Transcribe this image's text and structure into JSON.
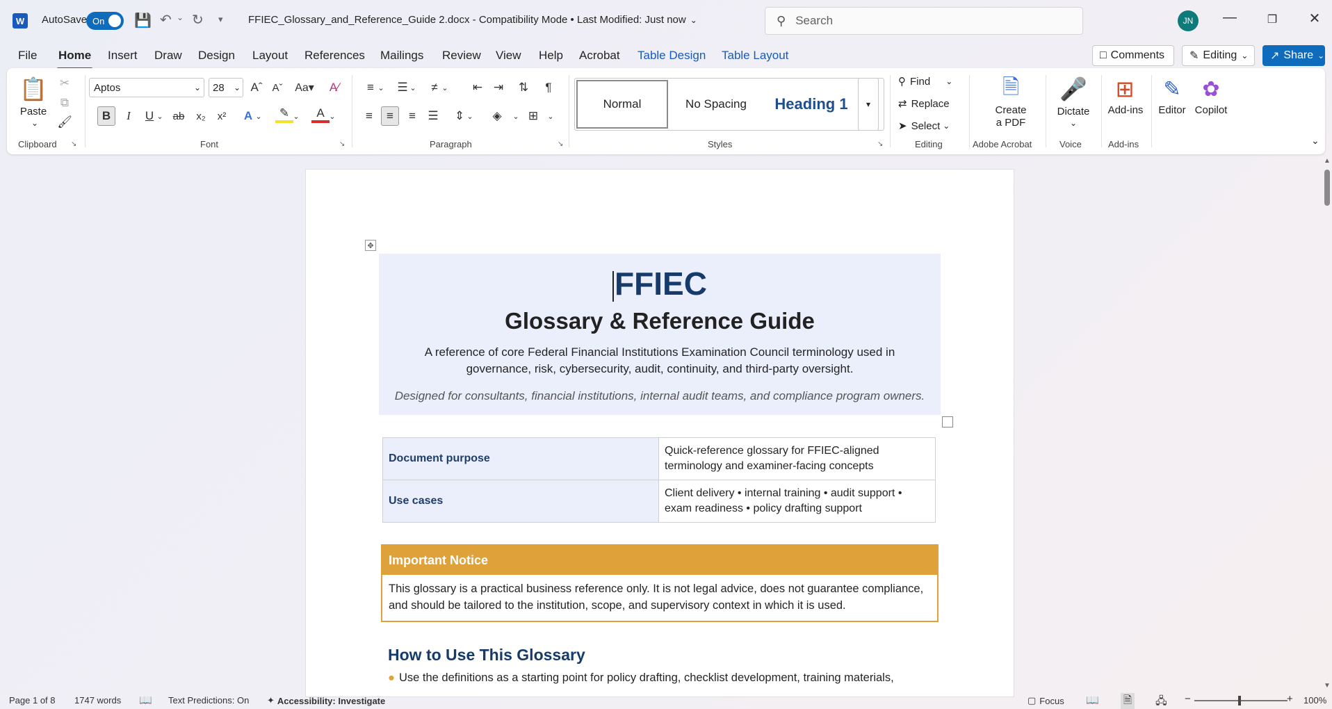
{
  "titlebar": {
    "app_logo": "W",
    "autosave_label": "AutoSave",
    "autosave_state": "On",
    "document_title": "FFIEC_Glossary_and_Reference_Guide 2.docx  -  Compatibility Mode •  Last Modified: Just now",
    "search_placeholder": "Search",
    "user_initials": "JN"
  },
  "menu": {
    "tabs": [
      "File",
      "Home",
      "Insert",
      "Draw",
      "Design",
      "Layout",
      "References",
      "Mailings",
      "Review",
      "View",
      "Help",
      "Acrobat",
      "Table Design",
      "Table Layout"
    ],
    "active_tab": "Home",
    "comments_label": "Comments",
    "editing_label": "Editing",
    "share_label": "Share"
  },
  "ribbon": {
    "clipboard": {
      "paste_label": "Paste",
      "group_label": "Clipboard"
    },
    "font": {
      "name": "Aptos",
      "size": "28",
      "group_label": "Font"
    },
    "paragraph": {
      "group_label": "Paragraph"
    },
    "styles": {
      "items": [
        "Normal",
        "No Spacing",
        "Heading 1"
      ],
      "group_label": "Styles"
    },
    "editing": {
      "find_label": "Find",
      "replace_label": "Replace",
      "select_label": "Select",
      "group_label": "Editing"
    },
    "acrobat": {
      "create_pdf_label_1": "Create",
      "create_pdf_label_2": "a PDF",
      "group_label": "Adobe Acrobat"
    },
    "voice": {
      "dictate_label": "Dictate",
      "group_label": "Voice"
    },
    "addins": {
      "addins_label": "Add-ins",
      "group_label": "Add-ins"
    },
    "editor_label": "Editor",
    "copilot_label": "Copilot"
  },
  "document": {
    "title": "FFIEC",
    "subtitle": "Glossary & Reference Guide",
    "description": "A reference of core Federal Financial Institutions Examination Council terminology used in governance, risk, cybersecurity, audit, continuity, and third-party oversight.",
    "tagline": "Designed for consultants, financial institutions, internal audit teams, and compliance program owners.",
    "info_rows": [
      {
        "key": "Document purpose",
        "value": "Quick-reference glossary for FFIEC-aligned terminology and examiner-facing concepts"
      },
      {
        "key": "Use cases",
        "value": "Client delivery • internal training • audit support • exam readiness • policy drafting support"
      }
    ],
    "notice_heading": "Important Notice",
    "notice_body": "This glossary is a practical business reference only. It is not legal advice, does not guarantee compliance, and should be tailored to the institution, scope, and supervisory context in which it is used.",
    "section_heading": "How to Use This Glossary",
    "bullet_1": "Use the definitions as a starting point for policy drafting, checklist development, training materials,"
  },
  "statusbar": {
    "page": "Page 1 of 8",
    "words": "1747 words",
    "text_predictions": "Text Predictions: On",
    "accessibility": "Accessibility: Investigate",
    "focus": "Focus",
    "zoom": "100%"
  },
  "colors": {
    "accent": "#0f6cbd",
    "notice": "#dfa23a",
    "heading": "#163b6b",
    "hero_bg": "#eaeffb"
  }
}
